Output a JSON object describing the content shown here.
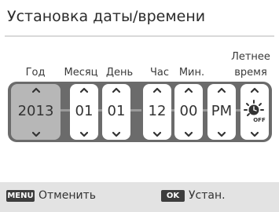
{
  "header": {
    "title": "Установка даты/времени"
  },
  "columns": [
    {
      "label": "Год",
      "value": "2013",
      "selected": true
    },
    {
      "label": "Месяц",
      "value": "01",
      "selected": false
    },
    {
      "label": "День",
      "value": "01",
      "selected": false
    },
    {
      "label": "Час",
      "value": "12",
      "selected": false
    },
    {
      "label": "Мин.",
      "value": "00",
      "selected": false
    },
    {
      "label": "",
      "value": "PM",
      "selected": false
    },
    {
      "label_line1": "Летнее",
      "label_line2": "время",
      "icon": "dst-off-icon",
      "icon_text": "OFF",
      "selected": false
    }
  ],
  "footer": {
    "menu_key": "MENU",
    "cancel_label": "Отменить",
    "ok_key": "OK",
    "set_label": "Устан."
  },
  "colors": {
    "tray": "#6b6b6b",
    "selected_cell": "#b7b7b7",
    "footer_bg": "#e3e3e3",
    "keycap": "#3d3d3d"
  }
}
